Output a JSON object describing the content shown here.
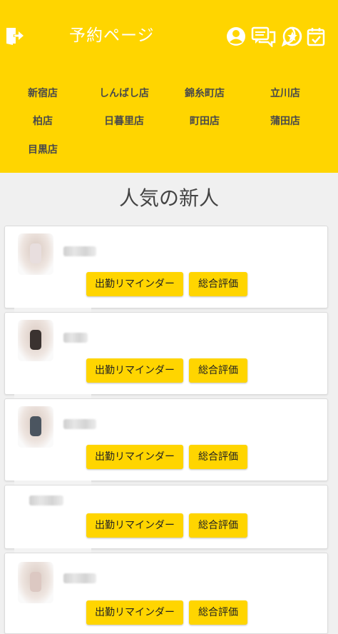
{
  "header": {
    "title": "予約ページ",
    "bg_color": "#FFD500",
    "icons": [
      "logout-icon",
      "account-icon",
      "chat-icon",
      "favorite-star-icon",
      "calendar-check-icon"
    ]
  },
  "stores": [
    "新宿店",
    "しんばし店",
    "錦糸町店",
    "立川店",
    "柏店",
    "日暮里店",
    "町田店",
    "蒲田店",
    "目黒店"
  ],
  "section_title": "人気の新人",
  "buttons": {
    "remind_label": "出勤リマインダー",
    "review_label": "総合評価"
  },
  "cards": [
    {
      "has_avatar": true
    },
    {
      "has_avatar": true
    },
    {
      "has_avatar": true
    },
    {
      "has_avatar": false
    },
    {
      "has_avatar": true
    }
  ]
}
